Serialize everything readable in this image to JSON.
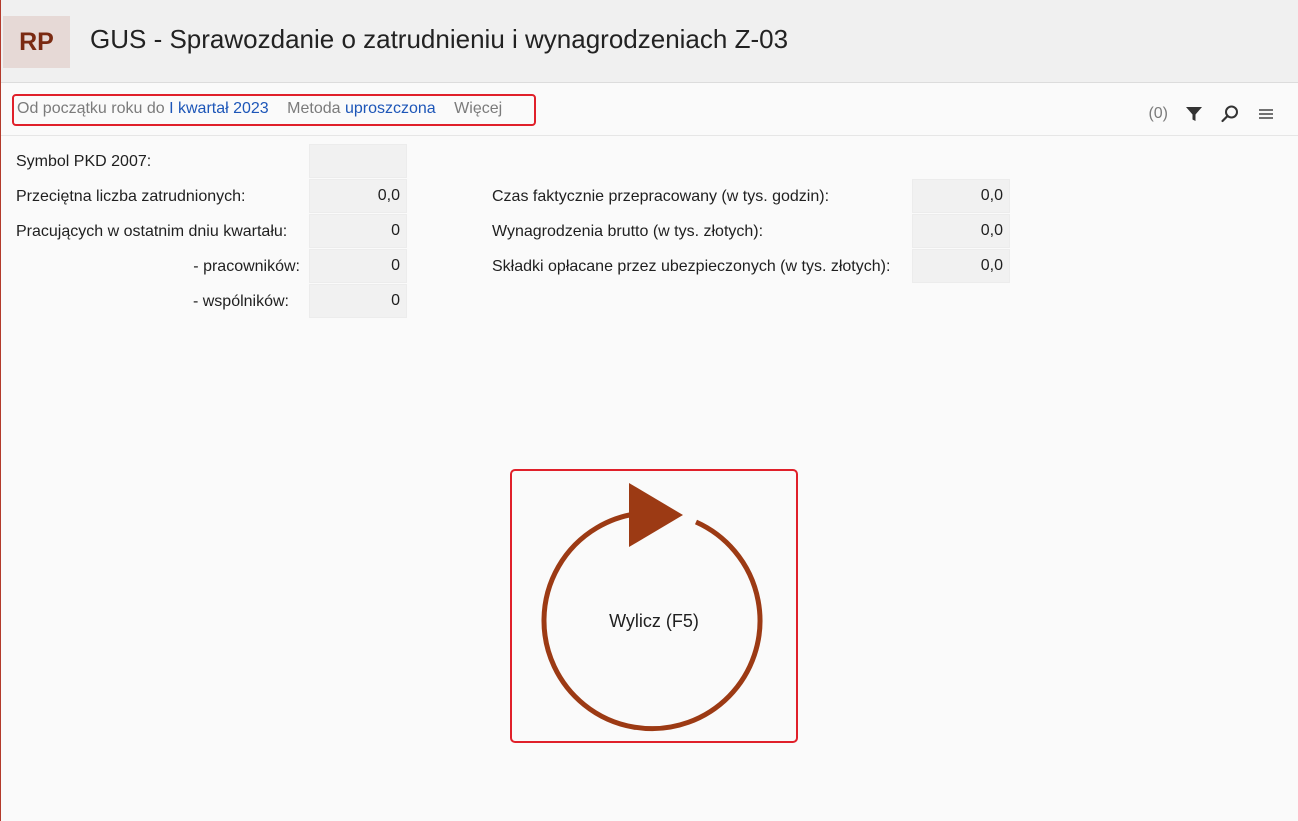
{
  "header": {
    "app_badge": "RP",
    "title": "GUS - Sprawozdanie o zatrudnieniu i wynagrodzeniach Z-03"
  },
  "filters": {
    "period_prefix": "Od początku roku do",
    "period_value": "I kwartał 2023",
    "method_prefix": "Metoda",
    "method_value": "uproszczona",
    "more_label": "Więcej"
  },
  "toolbar": {
    "filter_count": "(0)",
    "icons": [
      "filter-icon",
      "search-icon",
      "menu-icon"
    ]
  },
  "form": {
    "left": [
      {
        "label": "Symbol PKD 2007:",
        "value": ""
      },
      {
        "label": "Przeciętna liczba zatrudnionych:",
        "value": "0,0"
      },
      {
        "label": "Pracujących w ostatnim dniu kwartału:",
        "value": "0"
      },
      {
        "label": "- pracowników:",
        "value": "0"
      },
      {
        "label": "- wspólników:",
        "value": "0"
      }
    ],
    "right": [
      {
        "label": "Czas faktycznie przepracowany (w tys. godzin):",
        "value": "0,0"
      },
      {
        "label": "Wynagrodzenia brutto (w tys. złotych):",
        "value": "0,0"
      },
      {
        "label": "Składki opłacane przez ubezpieczonych (w tys. złotych):",
        "value": "0,0"
      }
    ]
  },
  "calculate": {
    "label": "Wylicz (F5)",
    "icon": "refresh-icon",
    "color": "#9c3a14"
  },
  "colors": {
    "accent": "#9c3a14",
    "link": "#1d56b8",
    "highlight": "#e0202a"
  }
}
